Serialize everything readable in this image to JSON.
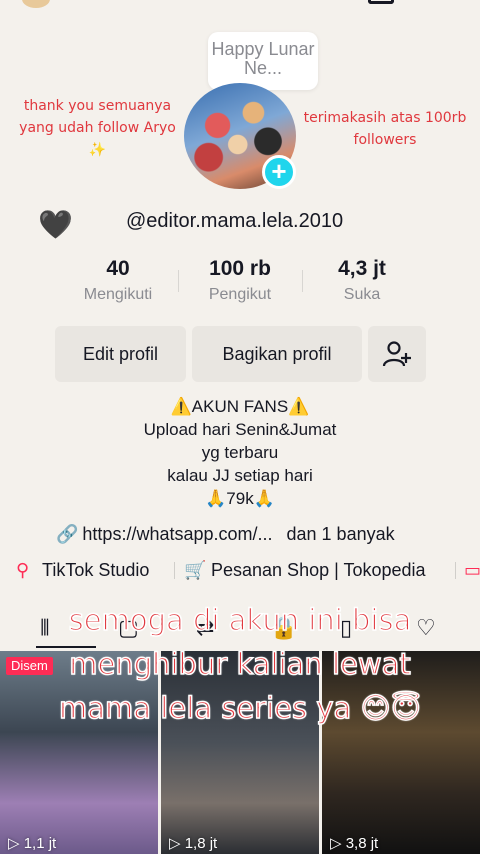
{
  "profile": {
    "story_bubble": "Happy Lunar Ne...",
    "username": "@editor.mama.lela.2010",
    "heart_icon": "🖤",
    "annotation_left": "thank you semuanya yang udah follow Aryo ✨",
    "annotation_right": "terimakasih atas 100rb followers"
  },
  "stats": [
    {
      "value": "40",
      "label": "Mengikuti"
    },
    {
      "value": "100 rb",
      "label": "Pengikut"
    },
    {
      "value": "4,3 jt",
      "label": "Suka"
    }
  ],
  "buttons": {
    "edit": "Edit profil",
    "share": "Bagikan profil",
    "add_friend_icon": "add-user-icon"
  },
  "bio": {
    "line1": "⚠️AKUN FANS⚠️",
    "line2": "Upload hari Senin&Jumat",
    "line3": "yg terbaru",
    "line4": "kalau JJ setiap hari",
    "line5": "🙏79k🙏"
  },
  "link": {
    "url": "https://whatsapp.com/...",
    "more": "dan 1 banyak"
  },
  "shortcuts": {
    "studio": "TikTok Studio",
    "shop": "Pesanan Shop | Tokopedia"
  },
  "overlay_caption": {
    "line1": "semoga di akun ini bisa",
    "line2": "menghibur kalian lewat",
    "line3": "mama lela series ya 😊😇"
  },
  "videos": [
    {
      "badge": "Disem",
      "views": "1,1 jt"
    },
    {
      "badge": "",
      "views": "1,8 jt"
    },
    {
      "badge": "",
      "views": "3,8 jt"
    }
  ],
  "colors": {
    "accent_pink": "#fe2c55",
    "annotation_red": "#e0383e",
    "plus_badge": "#20d5ec"
  }
}
